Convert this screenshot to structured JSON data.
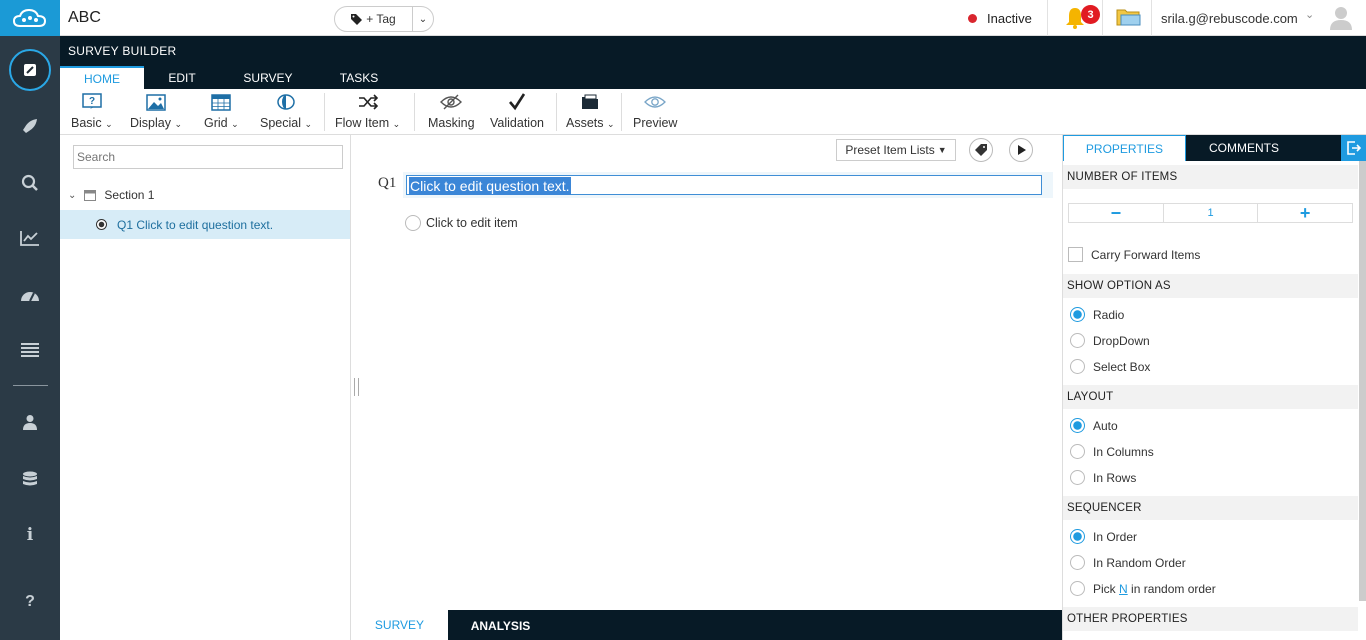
{
  "app": {
    "title": "ABC"
  },
  "tag": {
    "label": "+ Tag"
  },
  "status": {
    "text": "Inactive",
    "color": "#d9262e"
  },
  "notifications": {
    "count": "3"
  },
  "user": {
    "email": "srila.g@rebuscode.com"
  },
  "ribbon": {
    "title": "SURVEY BUILDER",
    "tabs": [
      "HOME",
      "EDIT",
      "SURVEY",
      "TASKS"
    ]
  },
  "toolbar": {
    "basic": "Basic",
    "display": "Display",
    "grid": "Grid",
    "special": "Special",
    "flow_item": "Flow Item",
    "masking": "Masking",
    "validation": "Validation",
    "assets": "Assets",
    "preview": "Preview"
  },
  "tree": {
    "search_placeholder": "Search",
    "section": "Section 1",
    "question": "Q1 Click to edit question text."
  },
  "canvas": {
    "preset_label": "Preset Item Lists",
    "q_number": "Q1",
    "q_text": "Click to edit question text.",
    "item_text": "Click to edit item"
  },
  "bottom_tabs": [
    "SURVEY",
    "ANALYSIS"
  ],
  "properties": {
    "tabs": [
      "PROPERTIES",
      "COMMENTS"
    ],
    "number_of_items": {
      "heading": "NUMBER OF ITEMS",
      "minus": "−",
      "value": "1",
      "plus": "+"
    },
    "carry_forward": "Carry Forward Items",
    "show_option_as": {
      "heading": "SHOW OPTION AS",
      "options": [
        "Radio",
        "DropDown",
        "Select Box"
      ],
      "selected": "Radio"
    },
    "layout": {
      "heading": "LAYOUT",
      "options": [
        "Auto",
        "In Columns",
        "In Rows"
      ],
      "selected": "Auto"
    },
    "sequencer": {
      "heading": "SEQUENCER",
      "options": [
        "In Order",
        "In Random Order"
      ],
      "selected": "In Order",
      "pick_prefix": "Pick ",
      "pick_link": "N",
      "pick_suffix": " in random order"
    },
    "other": {
      "heading": "OTHER PROPERTIES"
    }
  },
  "colors": {
    "accent": "#1f9be0",
    "dark": "#071a26",
    "rail": "#2b3a46"
  }
}
